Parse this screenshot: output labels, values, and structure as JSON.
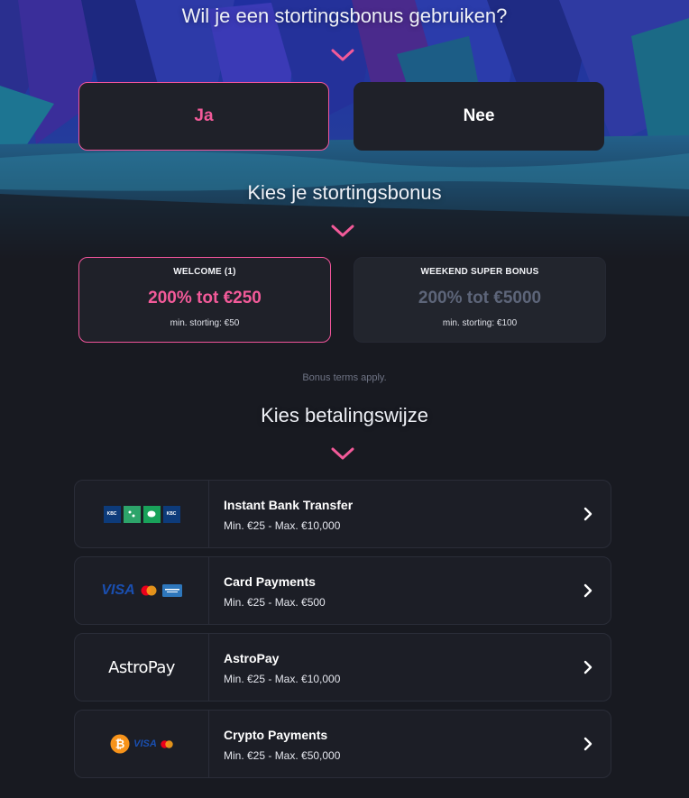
{
  "deposit_question": {
    "title": "Wil je een stortingsbonus gebruiken?",
    "yes_label": "Ja",
    "no_label": "Nee",
    "selected": "Ja"
  },
  "bonus_section": {
    "title": "Kies je stortingsbonus",
    "bonuses": [
      {
        "name": "WELCOME (1)",
        "amount": "200% tot €250",
        "min": "min. storting: €50",
        "selected": true
      },
      {
        "name": "WEEKEND SUPER BONUS",
        "amount": "200% tot €5000",
        "min": "min. storting: €100",
        "selected": false
      }
    ],
    "terms": "Bonus terms apply."
  },
  "payment_section": {
    "title": "Kies betalingswijze",
    "methods": [
      {
        "name": "Instant Bank Transfer",
        "limits": "Min. €25 - Max. €10,000",
        "logo": "kbc-belfius-bank-logos"
      },
      {
        "name": "Card Payments",
        "limits": "Min. €25 - Max. €500",
        "logo": "visa-mastercard-amex-logos"
      },
      {
        "name": "AstroPay",
        "limits": "Min. €25 - Max. €10,000",
        "logo": "astropay-logo",
        "logo_text": "AstroPay"
      },
      {
        "name": "Crypto Payments",
        "limits": "Min. €25 - Max. €50,000",
        "logo": "bitcoin-visa-mastercard-logos"
      }
    ]
  },
  "logo_text": {
    "kbc": "KBC",
    "visa": "VISA"
  },
  "colors": {
    "accent": "#f25a99",
    "background": "#181a21",
    "card": "#1f2129",
    "muted_amount": "#5d6579"
  }
}
